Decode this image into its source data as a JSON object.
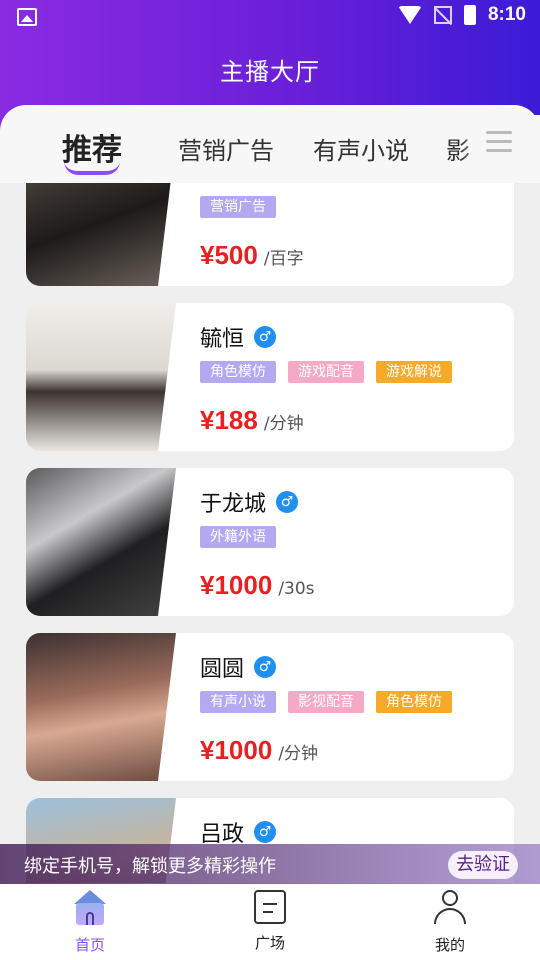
{
  "status_bar": {
    "time": "8:10"
  },
  "header": {
    "title": "主播大厅"
  },
  "tabs": [
    {
      "label": "推荐",
      "active": true
    },
    {
      "label": "营销广告",
      "active": false
    },
    {
      "label": "有声小说",
      "active": false
    },
    {
      "label": "影",
      "active": false
    }
  ],
  "anchors": [
    {
      "name": "",
      "gender_icon": "male-icon",
      "tags": [
        {
          "label": "营销广告",
          "color": "purple"
        }
      ],
      "price": "¥500",
      "unit": "/百字",
      "thumb_bg": "#2e2a28"
    },
    {
      "name": "毓恒",
      "gender_icon": "male-icon",
      "tags": [
        {
          "label": "角色模仿",
          "color": "purple"
        },
        {
          "label": "游戏配音",
          "color": "pink"
        },
        {
          "label": "游戏解说",
          "color": "orange"
        }
      ],
      "price": "¥188",
      "unit": "/分钟",
      "thumb_bg": "#e6e3de"
    },
    {
      "name": "于龙城",
      "gender_icon": "male-icon",
      "tags": [
        {
          "label": "外籍外语",
          "color": "purple"
        }
      ],
      "price": "¥1000",
      "unit": "/30s",
      "thumb_bg": "#3a3a3c"
    },
    {
      "name": "圆圆",
      "gender_icon": "male-icon",
      "tags": [
        {
          "label": "有声小说",
          "color": "purple"
        },
        {
          "label": "影视配音",
          "color": "pink"
        },
        {
          "label": "角色模仿",
          "color": "orange"
        }
      ],
      "price": "¥1000",
      "unit": "/分钟",
      "thumb_bg": "#7a5848"
    },
    {
      "name": "吕政",
      "gender_icon": "male-icon",
      "tags": [],
      "price": "",
      "unit": "",
      "thumb_bg": "#b7a48f"
    }
  ],
  "banner": {
    "text": "绑定手机号，解锁更多精彩操作",
    "button": "去验证"
  },
  "bottom_nav": [
    {
      "label": "首页",
      "active": true,
      "icon": "home-icon"
    },
    {
      "label": "广场",
      "active": false,
      "icon": "square-icon"
    },
    {
      "label": "我的",
      "active": false,
      "icon": "profile-icon"
    }
  ],
  "colors": {
    "accent": "#8a4dff",
    "price": "#e82020",
    "header_start": "#8a2be2",
    "header_end": "#3b1bd6"
  }
}
